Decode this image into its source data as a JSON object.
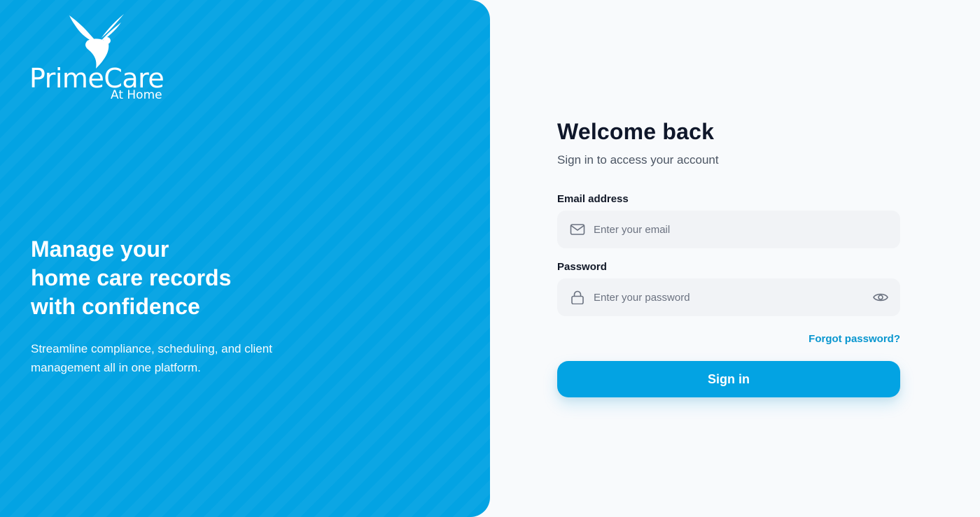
{
  "brand": {
    "name": "PrimeCare",
    "tagline": "At Home",
    "logo_icon": "dove-icon",
    "panel_color": "#03a3e3"
  },
  "hero": {
    "lines": [
      "Manage your",
      "home care records",
      "with confidence"
    ],
    "description": "Streamline compliance, scheduling, and client management all in one platform."
  },
  "form": {
    "title": "Welcome back",
    "subtitle": "Sign in to access your account",
    "email": {
      "label": "Email address",
      "placeholder": "Enter your email",
      "value": "",
      "icon": "mail-icon"
    },
    "password": {
      "label": "Password",
      "placeholder": "Enter your password",
      "value": "",
      "icon": "lock-icon",
      "toggle_icon": "eye-icon"
    },
    "forgot_label": "Forgot password?",
    "submit_label": "Sign in",
    "accent_color": "#03a3e3",
    "link_color": "#0896cf"
  }
}
